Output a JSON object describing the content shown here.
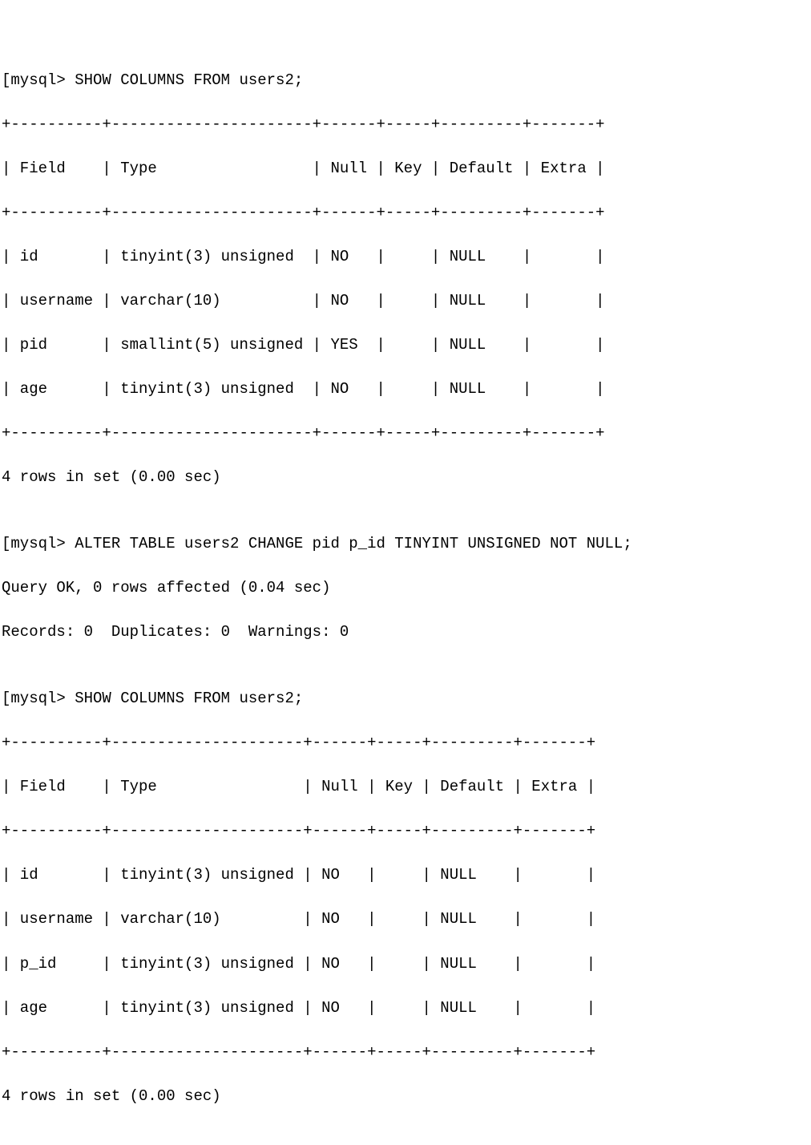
{
  "prompt": "[mysql> ",
  "cmd1": "SHOW COLUMNS FROM users2;",
  "t1": {
    "sep": "+----------+----------------------+------+-----+---------+-------+",
    "header": "| Field    | Type                 | Null | Key | Default | Extra |",
    "rows": [
      "| id       | tinyint(3) unsigned  | NO   |     | NULL    |       |",
      "| username | varchar(10)          | NO   |     | NULL    |       |",
      "| pid      | smallint(5) unsigned | YES  |     | NULL    |       |",
      "| age      | tinyint(3) unsigned  | NO   |     | NULL    |       |"
    ],
    "footer": "4 rows in set (0.00 sec)"
  },
  "blank": "",
  "cmd2": "ALTER TABLE users2 CHANGE pid p_id TINYINT UNSIGNED NOT NULL;",
  "res2a": "Query OK, 0 rows affected (0.04 sec)",
  "res2b": "Records: 0  Duplicates: 0  Warnings: 0",
  "cmd3": "SHOW COLUMNS FROM users2;",
  "t2": {
    "sep": "+----------+---------------------+------+-----+---------+-------+",
    "header": "| Field    | Type                | Null | Key | Default | Extra |",
    "rows": [
      "| id       | tinyint(3) unsigned | NO   |     | NULL    |       |",
      "| username | varchar(10)         | NO   |     | NULL    |       |",
      "| p_id     | tinyint(3) unsigned | NO   |     | NULL    |       |",
      "| age      | tinyint(3) unsigned | NO   |     | NULL    |       |"
    ],
    "footer": "4 rows in set (0.00 sec)"
  },
  "chart_data": {
    "type": "table",
    "title": "SHOW COLUMNS FROM users2 (before and after ALTER)",
    "before": {
      "columns": [
        "Field",
        "Type",
        "Null",
        "Key",
        "Default",
        "Extra"
      ],
      "rows": [
        [
          "id",
          "tinyint(3) unsigned",
          "NO",
          "",
          "NULL",
          ""
        ],
        [
          "username",
          "varchar(10)",
          "NO",
          "",
          "NULL",
          ""
        ],
        [
          "pid",
          "smallint(5) unsigned",
          "YES",
          "",
          "NULL",
          ""
        ],
        [
          "age",
          "tinyint(3) unsigned",
          "NO",
          "",
          "NULL",
          ""
        ]
      ],
      "summary": "4 rows in set (0.00 sec)"
    },
    "alter_statement": "ALTER TABLE users2 CHANGE pid p_id TINYINT UNSIGNED NOT NULL;",
    "alter_result": {
      "status": "Query OK, 0 rows affected (0.04 sec)",
      "records": 0,
      "duplicates": 0,
      "warnings": 0
    },
    "after": {
      "columns": [
        "Field",
        "Type",
        "Null",
        "Key",
        "Default",
        "Extra"
      ],
      "rows": [
        [
          "id",
          "tinyint(3) unsigned",
          "NO",
          "",
          "NULL",
          ""
        ],
        [
          "username",
          "varchar(10)",
          "NO",
          "",
          "NULL",
          ""
        ],
        [
          "p_id",
          "tinyint(3) unsigned",
          "NO",
          "",
          "NULL",
          ""
        ],
        [
          "age",
          "tinyint(3) unsigned",
          "NO",
          "",
          "NULL",
          ""
        ]
      ],
      "summary": "4 rows in set (0.00 sec)"
    }
  }
}
